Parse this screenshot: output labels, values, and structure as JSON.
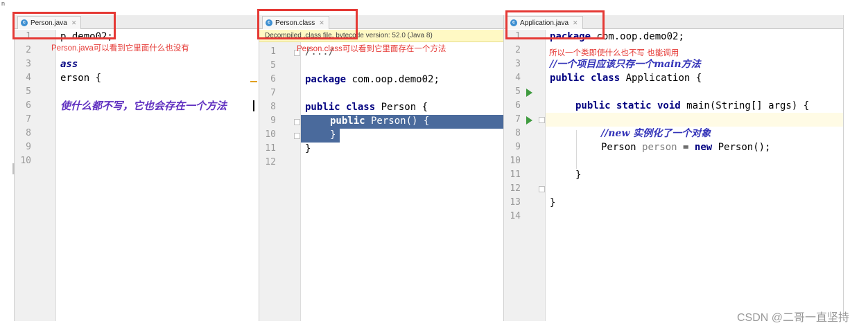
{
  "corner_text": "n",
  "panes": [
    {
      "tab": "Person.java",
      "annotation": "Person.java可以看到它里面什么也没有",
      "line_numbers": [
        "1",
        "2",
        "3",
        "4",
        "5",
        "6",
        "7",
        "8",
        "9",
        "10"
      ],
      "lines": {
        "l1": "p.demo02;",
        "l3": "ass",
        "l4": "erson {",
        "l6": "使什么都不写，它也会存在一个方法"
      }
    },
    {
      "tab": "Person.class",
      "banner": "Decompiled .class file, bytecode version: 52.0 (Java 8)",
      "annotation": "Person.class可以看到它里面存在一个方法",
      "line_numbers": [
        "1",
        "5",
        "6",
        "7",
        "8",
        "9",
        "10",
        "11",
        "12"
      ],
      "lines": {
        "l1": "/.../",
        "l6_kw": "package",
        "l6_rest": " com.oop.demo02;",
        "l8_kw": "public class",
        "l8_rest": " Person {",
        "l9_kw": "public",
        "l9_rest": " Person() {",
        "l10": "}",
        "l11": "}"
      }
    },
    {
      "tab": "Application.java",
      "annotation": "所以一个类即使什么也不写  也能调用",
      "line_numbers": [
        "1",
        "2",
        "3",
        "4",
        "5",
        "6",
        "7",
        "8",
        "9",
        "10",
        "11",
        "12",
        "13",
        "14"
      ],
      "lines": {
        "l1_kw": "package",
        "l1_rest": " com.oop.demo02;",
        "l3": "//一个项目应该只存一个main方法",
        "l4_kw": "public class",
        "l4_rest": " Application {",
        "l6_kw": "public static void",
        "l6_rest": " main(String[] args) {",
        "l8": "//new 实例化了一个对象",
        "l9_type": "Person ",
        "l9_var": "person",
        "l9_eq": " = ",
        "l9_kw": "new",
        "l9_rest": " Person();",
        "l11": "}",
        "l13": "}"
      }
    }
  ],
  "watermark": "CSDN @二哥一直坚持",
  "colors": {
    "red_box": "#e53935",
    "selection": "#4a6a9c",
    "keyword": "#000080",
    "comment": "#3333b8"
  }
}
